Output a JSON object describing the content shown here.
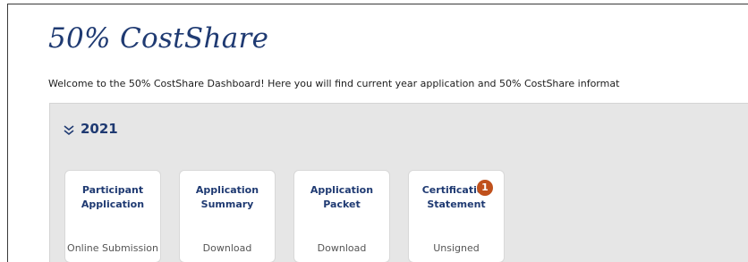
{
  "page": {
    "title": "50% CostShare",
    "welcome": "Welcome to the 50% CostShare Dashboard! Here you will find current year application and 50% CostShare informat"
  },
  "year_section": {
    "year": "2021",
    "toggle_icon": "double-chevron-down-icon"
  },
  "cards": [
    {
      "title": "Participant Application",
      "status": "Online Submission"
    },
    {
      "title": "Application Summary",
      "status": "Download"
    },
    {
      "title": "Application Packet",
      "status": "Download"
    },
    {
      "title": "Certification Statement",
      "status": "Unsigned",
      "badge": "1"
    }
  ],
  "colors": {
    "brand_blue": "#1f3a72",
    "badge_orange": "#c0511c",
    "panel_gray": "#e6e6e6"
  }
}
